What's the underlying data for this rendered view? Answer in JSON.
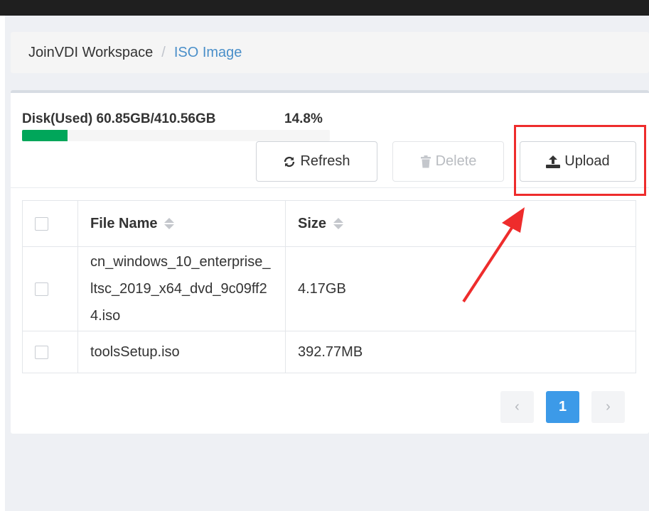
{
  "breadcrumb": {
    "root": "JoinVDI Workspace",
    "separator": "/",
    "current": "ISO Image"
  },
  "disk": {
    "label": "Disk(Used) 60.85GB/410.56GB",
    "percent_text": "14.8%",
    "used_fraction": 0.148
  },
  "toolbar": {
    "refresh_label": "Refresh",
    "delete_label": "Delete",
    "upload_label": "Upload"
  },
  "table": {
    "columns": [
      "File Name",
      "Size"
    ],
    "rows": [
      {
        "name": "cn_windows_10_enterprise_ltsc_2019_x64_dvd_9c09ff24.iso",
        "size": "4.17GB"
      },
      {
        "name": "toolsSetup.iso",
        "size": "392.77MB"
      }
    ]
  },
  "pagination": {
    "prev": "‹",
    "current": "1",
    "next": "›"
  },
  "annotation": {
    "highlight_color": "#ee2c2c"
  },
  "colors": {
    "progress": "#00a65a",
    "link": "#4a8fc9",
    "page_active": "#3c9ae8"
  }
}
